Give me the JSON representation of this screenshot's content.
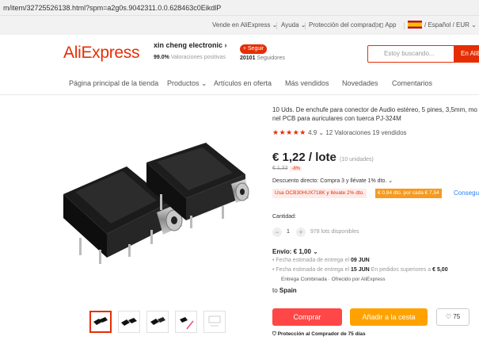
{
  "browser": {
    "url": "m/item/32725526138.html?spm=a2g0s.9042311.0.0.628463c0EikdlP"
  },
  "topbar": {
    "sell": "Vende en AliExpress",
    "help": "Ayuda",
    "protection": "Protección del comprador",
    "app": "App",
    "locale": "/ Español / EUR"
  },
  "header": {
    "logo": "AliExpress",
    "store_name": "xin cheng electronic",
    "positive_pct": "99.0%",
    "positive_label": "Valoraciones positivas",
    "follow_label": "+ Seguir",
    "followers_count": "20101",
    "followers_label": "Seguidores",
    "search_placeholder": "Estoy buscando...",
    "search_button": "En AliE"
  },
  "nav": {
    "items": [
      "Página principal de la tienda",
      "Productos",
      "Artículos en oferta",
      "Más vendidos",
      "Novedades",
      "Comentarios"
    ]
  },
  "product": {
    "title": "10 Uds. De enchufe para conector de Audio estéreo, 5 pines, 3,5mm, mo nel PCB para auriculares con tuerca PJ-324M",
    "stars": "★★★★★",
    "rating": "4.9",
    "reviews": "12 Valoraciones",
    "sold": "19 vendidos",
    "price": "€ 1,22 / lote",
    "units": "(10 unidades)",
    "old_price": "€ 1,33",
    "discount": "-8%",
    "direct_discount": "Descuento directo: Compra 3 y llévate 1% dto.",
    "coupon1": "Usa OCB30HUX718K y llévate 2% dto.",
    "coupon2": "€ 0,84 dto. por cada € 7,54",
    "coupon_link": "Conseguir",
    "qty_label": "Cantidad:",
    "qty_value": "1",
    "lots_available": "978 lots disponibles",
    "shipping_label": "Envío: € 1,00",
    "ship_line1_prefix": "Fecha estimada de entrega el",
    "ship_line1_date": "09 JUN",
    "ship_line2_prefix": "Fecha estimada de entrega el",
    "ship_line2_date": "15 JUN",
    "ship_line2_suffix": "En pedidos superiores a",
    "ship_line2_amount": "€ 5,00",
    "combined": "Entrega Combinada · Ofrecido por AliExpress",
    "to_prefix": "to",
    "to_country": "Spain",
    "buy_label": "Comprar",
    "cart_label": "Añadir a la cesta",
    "wish_count": "75",
    "protection_label": "Protección al Comprador de 75 días"
  },
  "colors": {
    "accent": "#e62e04",
    "buy": "#ff4747",
    "cart": "#ffa200",
    "link": "#2f80ed"
  }
}
